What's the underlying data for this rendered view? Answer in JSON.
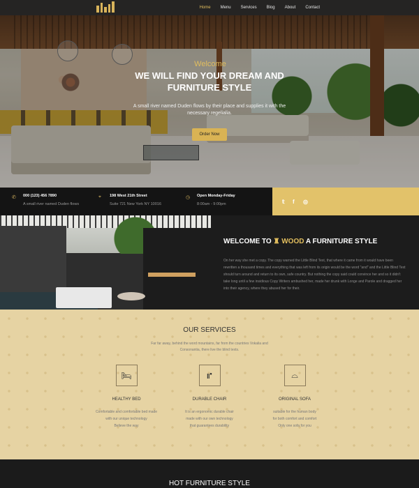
{
  "nav": {
    "menu": [
      "Home",
      "Menu",
      "Services",
      "Blog",
      "About",
      "Contact"
    ],
    "active": "Home"
  },
  "hero": {
    "welcome": "Welcome",
    "headline_line1": "WE WILL FIND YOUR DREAM AND",
    "headline_line2": "FURNITURE STYLE",
    "sub_line1": "A small river named Duden flows by their place and supplies it with the",
    "sub_line2": "necessary regelialia.",
    "button": "Order Now"
  },
  "info": {
    "phone": {
      "title": "000 (123) 456 7890",
      "desc": "A small river named Duden flows",
      "icon": "phone-icon"
    },
    "address": {
      "title": "198 West 21th Street",
      "desc": "Suite 721 New York NY 10016",
      "icon": "map-pin-icon"
    },
    "hours": {
      "title": "Open Monday-Friday",
      "desc": "8:00am - 9:00pm",
      "icon": "clock-icon"
    }
  },
  "social": [
    "twitter-icon",
    "facebook-icon",
    "instagram-icon"
  ],
  "about": {
    "title_pre": "WELCOME TO",
    "title_brand": "WOOD",
    "title_post": "A FURNITURE STYLE",
    "body": "On her way she met a copy. The copy warned the Little Blind Text, that where it came from it would have been rewritten a thousand times and everything that was left from its origin would be the word \"and\" and the Little Blind Text should turn around and return to its own, safe country. But nothing the copy said could convince her and so it didn't take long until a few insidious Copy Writers ambushed her, made her drunk with Longe and Parole and dragged her into their agency, where they abused her for their."
  },
  "services": {
    "title": "OUR SERVICES",
    "intro_line1": "Far far away, behind the word mountains, far from the countries Vokalia and",
    "intro_line2": "Consonantia, there live the blind texts.",
    "items": [
      {
        "icon": "bed-icon",
        "name": "HEALTHY BED",
        "desc": [
          "Comfortable and comfortable bed made",
          "with our unique technology",
          "Believe the way"
        ]
      },
      {
        "icon": "chair-icon",
        "name": "DURABLE CHAIR",
        "desc": [
          "It is an ergonomic durable chair",
          "made with our own technology",
          "that guarantees durability"
        ]
      },
      {
        "icon": "sofa-icon",
        "name": "ORIGINAL SOFA",
        "desc": [
          "suitable for the human body",
          "for both comfort and comfort",
          "Only one sofa for you"
        ]
      }
    ]
  },
  "hot": {
    "title": "HOT FURNITURE STYLE"
  },
  "colors": {
    "accent": "#e2be5e",
    "dark": "#1c1c1c",
    "sand": "#e6d3a3"
  }
}
